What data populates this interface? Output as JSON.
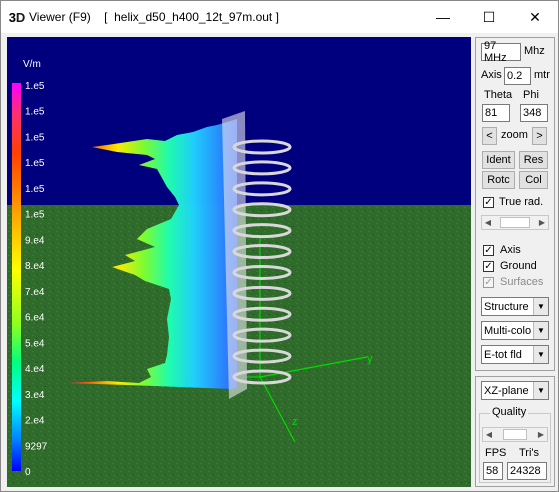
{
  "window": {
    "title": "Viewer (F9)    [  helix_d50_h400_12t_97m.out ]",
    "icon_label_3": "3",
    "icon_label_d": "D",
    "minimize": "—",
    "maximize": "☐",
    "close": "✕"
  },
  "legend": {
    "unit": "V/m",
    "labels": [
      "1.e5",
      "1.e5",
      "1.e5",
      "1.e5",
      "1.e5",
      "1.e5",
      "9.e4",
      "8.e4",
      "7.e4",
      "6.e4",
      "5.e4",
      "4.e4",
      "3.e4",
      "2.e4",
      "9297",
      "0"
    ]
  },
  "scene": {
    "axis_y_label": "y",
    "axis_z_label": "z"
  },
  "panel": {
    "freq_value": "97 MHz",
    "freq_unit": "Mhz",
    "axis_label": "Axis",
    "axis_value": "0.2",
    "axis_unit": "mtr",
    "theta_label": "Theta",
    "phi_label": "Phi",
    "theta_value": "81",
    "phi_value": "348",
    "zoom_left": "<",
    "zoom_label": "zoom",
    "zoom_right": ">",
    "ident": "Ident",
    "res": "Res",
    "rotc": "Rotc",
    "col": "Col",
    "true_rad_label": "True rad.",
    "true_rad_checked": "✓",
    "axis_cb_label": "Axis",
    "axis_cb_checked": "✓",
    "ground_label": "Ground",
    "ground_checked": "✓",
    "surfaces_label": "Surfaces",
    "surfaces_checked": "✓",
    "structure_select": "Structure",
    "multicolor_select": "Multi-colo",
    "etot_select": "E-tot fld",
    "plane_select": "XZ-plane",
    "quality_label": "Quality",
    "fps_label": "FPS",
    "tris_label": "Tri's",
    "fps_value": "58",
    "tris_value": "24328",
    "dropdown_arrow": "▼",
    "slider_left": "◀",
    "slider_right": "▶"
  }
}
